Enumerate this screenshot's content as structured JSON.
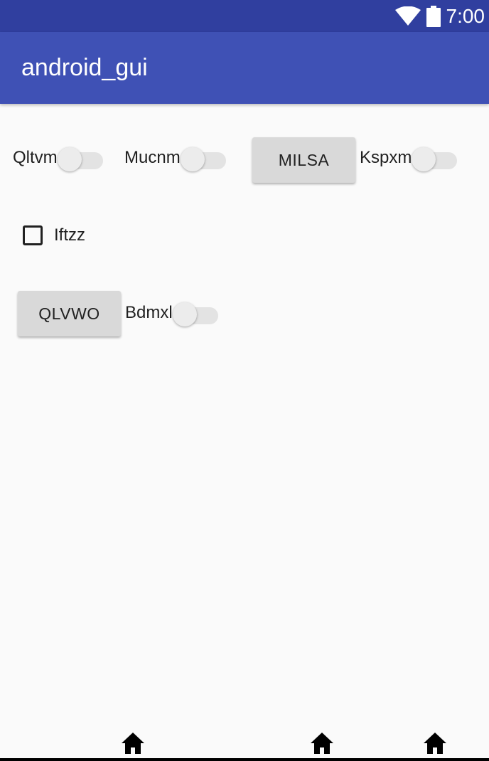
{
  "status_bar": {
    "time": "7:00",
    "icons": [
      "wifi-icon",
      "battery-icon"
    ],
    "color": "#303f9f"
  },
  "app_bar": {
    "title": "android_gui",
    "color": "#3f51b5"
  },
  "content": {
    "switches": [
      {
        "label": "Qltvm",
        "checked": false
      },
      {
        "label": "Mucnm",
        "checked": false
      },
      {
        "label": "Kspxm",
        "checked": false
      },
      {
        "label": "Bdmxl",
        "checked": false
      }
    ],
    "buttons": [
      {
        "label": "MILSA"
      },
      {
        "label": "QLVWO"
      }
    ],
    "checkbox": {
      "label": "Iftzz",
      "checked": false
    }
  },
  "nav_bar": {
    "buttons": [
      "home-icon",
      "home-icon",
      "home-icon"
    ]
  }
}
